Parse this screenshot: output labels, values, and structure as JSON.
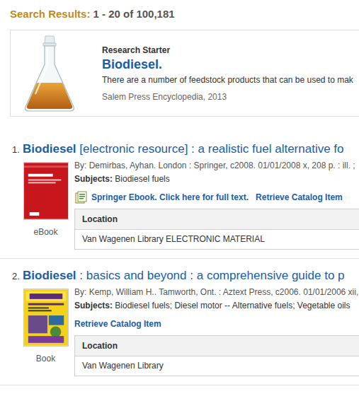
{
  "search_results": {
    "label": "Search Results:",
    "range": "1 - 20 of 100,181"
  },
  "research_starter": {
    "label": "Research Starter",
    "title": "Biodiesel.",
    "snippet": "There are a number of feedstock products that can be used to mak",
    "source": "Salem Press Encyclopedia, 2013"
  },
  "results": [
    {
      "number": "1.",
      "title_highlight": "Biodiesel",
      "title_rest": " [electronic resource] : a realistic fuel alternative fo",
      "byline": "By: Demirbas, Ayhan. London : Springer, c2008. 01/01/2008 x, 208 p. : ill. ;",
      "subjects_label": "Subjects:",
      "subjects": " Biodiesel fuels",
      "links": [
        {
          "text": "Springer Ebook. Click here for full text.",
          "kind": "fulltext"
        },
        {
          "text": "Retrieve Catalog Item",
          "kind": "catalog"
        }
      ],
      "format": "eBook",
      "kind": "ebook",
      "location_header": "Location",
      "location": "Van Wagenen Library ELECTRONIC MATERIAL"
    },
    {
      "number": "2.",
      "title_highlight": "Biodiesel",
      "title_rest": " : basics and beyond : a comprehensive guide to p",
      "byline": "By: Kemp, William H.. Tamworth, Ont. : Aztext Press, c2006. 01/01/2006 xii,",
      "subjects_label": "Subjects:",
      "subjects": " Biodiesel fuels; Diesel motor -- Alternative fuels; Vegetable oils",
      "links": [
        {
          "text": "Retrieve Catalog Item",
          "kind": "catalog"
        }
      ],
      "format": "Book",
      "kind": "book",
      "location_header": "Location",
      "location": "Van Wagenen Library"
    }
  ]
}
